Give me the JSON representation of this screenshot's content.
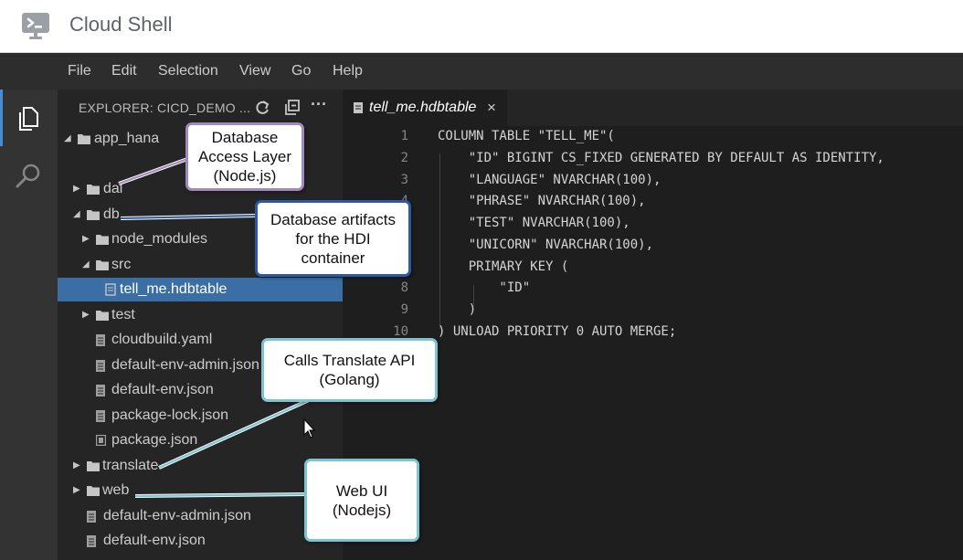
{
  "app": {
    "title": "Cloud Shell"
  },
  "menu": [
    "File",
    "Edit",
    "Selection",
    "View",
    "Go",
    "Help"
  ],
  "explorer": {
    "title": "EXPLORER: CICD_DEMO ..."
  },
  "tree": [
    {
      "label": "app_hana",
      "type": "folder",
      "expanded": true,
      "depth": 0
    },
    {
      "label": "dal",
      "type": "folder",
      "expanded": false,
      "depth": 1
    },
    {
      "label": "db",
      "type": "folder",
      "expanded": true,
      "depth": 1
    },
    {
      "label": "node_modules",
      "type": "folder",
      "expanded": false,
      "depth": 2
    },
    {
      "label": "src",
      "type": "folder",
      "expanded": true,
      "depth": 2
    },
    {
      "label": "tell_me.hdbtable",
      "type": "file",
      "depth": 3,
      "selected": true
    },
    {
      "label": "test",
      "type": "folder",
      "expanded": false,
      "depth": 2
    },
    {
      "label": "cloudbuild.yaml",
      "type": "file",
      "depth": 2
    },
    {
      "label": "default-env-admin.json",
      "type": "file",
      "depth": 2
    },
    {
      "label": "default-env.json",
      "type": "file",
      "depth": 2
    },
    {
      "label": "package-lock.json",
      "type": "file",
      "depth": 2
    },
    {
      "label": "package.json",
      "type": "file",
      "depth": 2
    },
    {
      "label": "translate",
      "type": "folder",
      "expanded": false,
      "depth": 1
    },
    {
      "label": "web",
      "type": "folder",
      "expanded": false,
      "depth": 1
    },
    {
      "label": "default-env-admin.json",
      "type": "file",
      "depth": 1
    },
    {
      "label": "default-env.json",
      "type": "file",
      "depth": 1
    }
  ],
  "editor": {
    "tab": {
      "name": "tell_me.hdbtable",
      "close": "×"
    },
    "lines": [
      {
        "n": "1",
        "text": "COLUMN TABLE \"TELL_ME\"("
      },
      {
        "n": "2",
        "text": "    \"ID\" BIGINT CS_FIXED GENERATED BY DEFAULT AS IDENTITY,"
      },
      {
        "n": "3",
        "text": "    \"LANGUAGE\" NVARCHAR(100),"
      },
      {
        "n": "4",
        "text": "    \"PHRASE\" NVARCHAR(100),"
      },
      {
        "n": "5",
        "text": "    \"TEST\" NVARCHAR(100),"
      },
      {
        "n": "6",
        "text": "    \"UNICORN\" NVARCHAR(100),"
      },
      {
        "n": "7",
        "text": "    PRIMARY KEY ("
      },
      {
        "n": "8",
        "text": "        \"ID\""
      },
      {
        "n": "9",
        "text": "    )"
      },
      {
        "n": "10",
        "text": ") UNLOAD PRIORITY 0 AUTO MERGE;"
      }
    ]
  },
  "callouts": {
    "dal": "Database\nAccess Layer\n(Node.js)",
    "db": "Database artifacts\nfor the HDI\ncontainer",
    "translate": "Calls Translate API\n(Golang)",
    "web": "Web UI\n(Nodejs)"
  },
  "colors": {
    "menubar": "#2d2d2d",
    "sidebar": "#252526",
    "editor": "#1e1e1e",
    "selection": "#3a6ea5",
    "activity_accent": "#4a8bd6",
    "callout_purple": "#a08ab8",
    "callout_blue": "#2b5aa0",
    "callout_cyan": "#7ec3d1"
  }
}
